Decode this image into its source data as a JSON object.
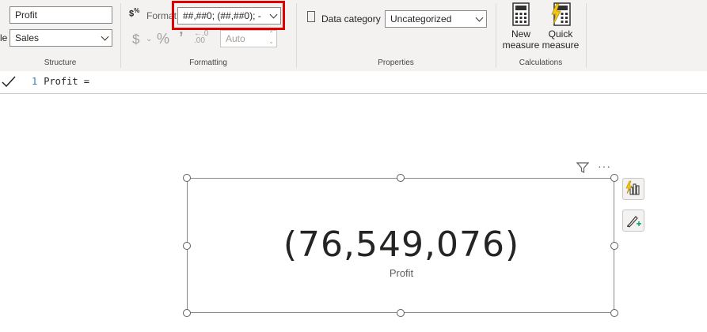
{
  "structure": {
    "name_value": "Profit",
    "table_label_fragment": "le",
    "table_value": "Sales",
    "group_label": "Structure"
  },
  "formatting": {
    "format_label": "Format",
    "format_value": "##,##0; (##,##0); -",
    "currency_symbol": "$",
    "percent_symbol": "%",
    "comma_symbol": "’",
    "decimal_value": "Auto",
    "group_label": "Formatting"
  },
  "properties": {
    "data_category_label": "Data category",
    "data_category_value": "Uncategorized",
    "group_label": "Properties"
  },
  "calculations": {
    "new_measure_line1": "New",
    "new_measure_line2": "measure",
    "quick_measure_line1": "Quick",
    "quick_measure_line2": "measure",
    "group_label": "Calculations"
  },
  "formula_bar": {
    "line_number": "1",
    "text": "Profit ="
  },
  "card_visual": {
    "value": "(76,549,076)",
    "label": "Profit"
  },
  "colors": {
    "highlight": "#e00000",
    "accent_yellow": "#f2c811"
  }
}
